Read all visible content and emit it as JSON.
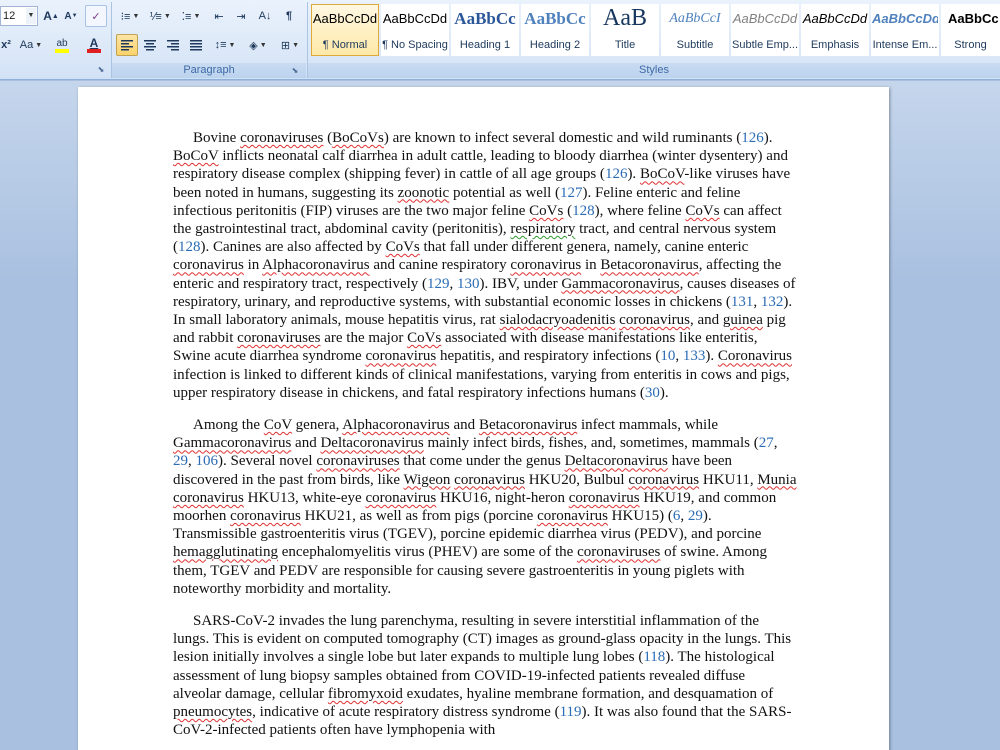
{
  "ribbon": {
    "font": {
      "size": "12",
      "grow_label": "A",
      "shrink_label": "A",
      "clear_label": "✓",
      "superscript_label": "x²",
      "change_case_label": "Aa",
      "highlight_label": "ab",
      "font_color_label": "A"
    },
    "paragraph": {
      "label": "Paragraph",
      "sort_label": "A↓",
      "show_marks_label": "¶"
    },
    "styles": {
      "label": "Styles",
      "items": [
        {
          "preview": "AaBbCcDd",
          "name": "¶ Normal"
        },
        {
          "preview": "AaBbCcDd",
          "name": "¶ No Spacing"
        },
        {
          "preview": "AaBbCc",
          "name": "Heading 1"
        },
        {
          "preview": "AaBbCc",
          "name": "Heading 2"
        },
        {
          "preview": "AaB",
          "name": "Title"
        },
        {
          "preview": "AaBbCcI",
          "name": "Subtitle"
        },
        {
          "preview": "AaBbCcDd",
          "name": "Subtle Emp..."
        },
        {
          "preview": "AaBbCcDd",
          "name": "Emphasis"
        },
        {
          "preview": "AaBbCcDd",
          "name": "Intense Em..."
        },
        {
          "preview": "AaBbCcDd",
          "name": "Strong"
        }
      ]
    }
  },
  "document": {
    "p1": [
      "Bovine ",
      {
        "t": "coronaviruses",
        "s": 1
      },
      " (",
      {
        "t": "BoCoVs",
        "s": 1
      },
      ") are known to infect several domestic and wild ruminants (",
      {
        "t": "126",
        "r": 1
      },
      "). ",
      {
        "t": "BoCoV",
        "s": 1
      },
      " inflicts neonatal calf diarrhea in adult cattle, leading to bloody diarrhea (winter dysentery) and respiratory disease complex (shipping fever) in cattle of all age groups (",
      {
        "t": "126",
        "r": 1
      },
      "). ",
      {
        "t": "BoCoV",
        "s": 1
      },
      "-like viruses have been noted in humans, suggesting its ",
      {
        "t": "zoonotic",
        "s": 1
      },
      " potential as well (",
      {
        "t": "127",
        "r": 1
      },
      "). Feline enteric and feline infectious peritonitis (FIP) viruses are the two major feline ",
      {
        "t": "CoVs",
        "s": 1
      },
      " (",
      {
        "t": "128",
        "r": 1
      },
      "), where feline ",
      {
        "t": "CoVs",
        "s": 1
      },
      " can affect the gastrointestinal tract, abdominal cavity (peritonitis), ",
      {
        "t": " respiratory",
        "g": 1
      },
      " tract, and central nervous system (",
      {
        "t": "128",
        "r": 1
      },
      "). Canines are also affected by ",
      {
        "t": "CoVs",
        "s": 1
      },
      " that fall under different genera, namely, canine enteric ",
      {
        "t": "coronavirus",
        "s": 1
      },
      " in ",
      {
        "t": "Alphacoronavirus",
        "s": 1
      },
      " and canine respiratory ",
      {
        "t": "coronavirus",
        "s": 1
      },
      " in ",
      {
        "t": "Betacoronavirus",
        "s": 1
      },
      ", affecting the enteric and respiratory tract, respectively (",
      {
        "t": "129",
        "r": 1
      },
      ", ",
      {
        "t": "130",
        "r": 1
      },
      "). IBV, under ",
      {
        "t": "Gammacoronavirus",
        "s": 1
      },
      ", causes diseases of respiratory, urinary, and reproductive systems, with substantial economic losses in chickens (",
      {
        "t": "131",
        "r": 1
      },
      ", ",
      {
        "t": "132",
        "r": 1
      },
      "). In small laboratory animals, mouse hepatitis virus, rat ",
      {
        "t": "sialodacryoadenitis",
        "s": 1
      },
      " ",
      {
        "t": "coronavirus",
        "s": 1
      },
      ", and ",
      {
        "t": "guinea",
        "s": 1
      },
      " pig and rabbit ",
      {
        "t": "coronaviruses",
        "s": 1
      },
      " are the major ",
      {
        "t": "CoVs",
        "s": 1
      },
      " associated with disease manifestations like enteritis, Swine acute diarrhea syndrome ",
      {
        "t": "coronavirus",
        "s": 1
      },
      " hepatitis, and respiratory infections (",
      {
        "t": "10",
        "r": 1
      },
      ", ",
      {
        "t": "133",
        "r": 1
      },
      "). ",
      {
        "t": "Coronavirus",
        "s": 1
      },
      " infection is linked to different kinds of clinical manifestations, varying from enteritis in cows and pigs, upper respiratory disease in chickens, and fatal respiratory infections humans (",
      {
        "t": "30",
        "r": 1
      },
      ")."
    ],
    "p2": [
      "Among the ",
      {
        "t": "CoV",
        "s": 1
      },
      " genera, ",
      {
        "t": "Alphacoronavirus",
        "s": 1
      },
      " and ",
      {
        "t": "Betacoronavirus",
        "s": 1
      },
      " infect mammals, while ",
      {
        "t": "Gammacoronavirus",
        "s": 1
      },
      " and ",
      {
        "t": "Deltacoronavirus",
        "s": 1
      },
      " mainly infect birds, fishes, and, sometimes, mammals (",
      {
        "t": "27",
        "r": 1
      },
      ", ",
      {
        "t": "29",
        "r": 1
      },
      ", ",
      {
        "t": "106",
        "r": 1
      },
      "). Several novel ",
      {
        "t": "coronaviruses",
        "s": 1
      },
      " that come under the genus ",
      {
        "t": "Deltacoronavirus",
        "s": 1
      },
      " have been discovered in the past from birds, like ",
      {
        "t": "Wigeon",
        "s": 1
      },
      " ",
      {
        "t": "coronavirus",
        "s": 1
      },
      " HKU20, Bulbul ",
      {
        "t": "coronavirus",
        "s": 1
      },
      " HKU11, ",
      {
        "t": "Munia",
        "s": 1
      },
      " ",
      {
        "t": "coronavirus",
        "s": 1
      },
      " HKU13, white-eye ",
      {
        "t": "coronavirus",
        "s": 1
      },
      " HKU16, night-heron ",
      {
        "t": "coronavirus",
        "s": 1
      },
      " HKU19, and common moorhen ",
      {
        "t": "coronavirus",
        "s": 1
      },
      " HKU21, as well as from pigs (porcine ",
      {
        "t": "coronavirus",
        "s": 1
      },
      " HKU15) (",
      {
        "t": "6",
        "r": 1
      },
      ", ",
      {
        "t": "29",
        "r": 1
      },
      "). Transmissible gastroenteritis virus (TGEV), porcine epidemic diarrhea virus (PEDV), and porcine ",
      {
        "t": "hemagglutinating",
        "s": 1
      },
      " encephalomyelitis virus (PHEV) are some of the ",
      {
        "t": "coronaviruses",
        "s": 1
      },
      " of swine. Among them, TGEV and PEDV are responsible for causing severe gastroenteritis in young piglets with noteworthy morbidity and mortality."
    ],
    "p3": [
      "SARS-CoV-2 invades the lung parenchyma, resulting in severe interstitial inflammation of the lungs. This is evident on computed tomography (CT) images as ground-glass opacity in the lungs. This lesion initially involves a single lobe but later expands to multiple lung lobes (",
      {
        "t": "118",
        "r": 1
      },
      "). The histological assessment of lung biopsy samples obtained from COVID-19-infected patients revealed diffuse alveolar damage, cellular ",
      {
        "t": "fibromyxoid",
        "s": 1
      },
      " exudates, hyaline membrane formation, and desquamation of ",
      {
        "t": "pneumocytes",
        "s": 1
      },
      ", indicative of acute respiratory distress syndrome (",
      {
        "t": "119",
        "r": 1
      },
      "). It was also found that the SARS-CoV-2-infected patients often have lymphopenia with"
    ]
  }
}
